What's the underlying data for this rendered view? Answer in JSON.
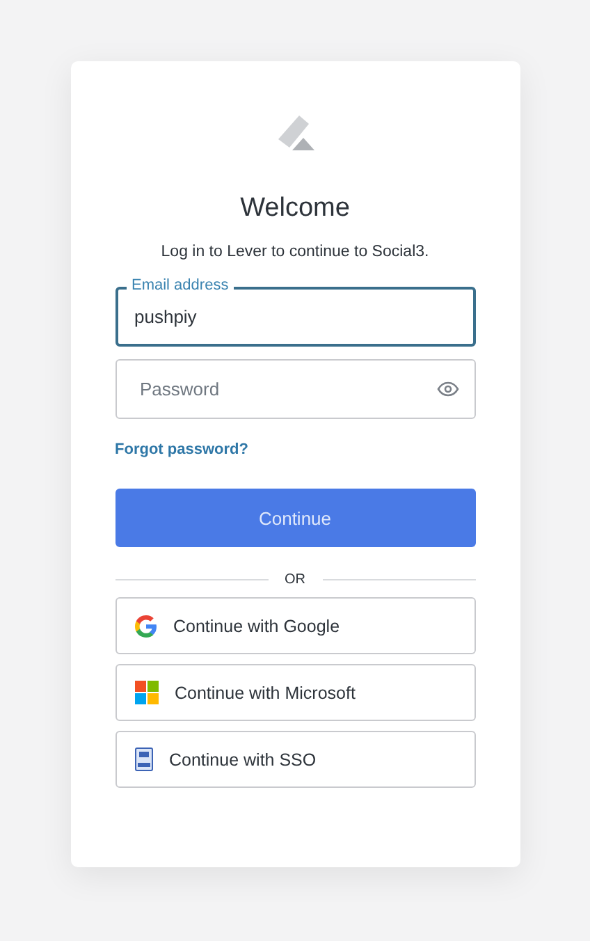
{
  "heading": "Welcome",
  "subtitle": "Log in to Lever to continue to Social3.",
  "email": {
    "label": "Email address",
    "value": "pushpiy",
    "focused": true
  },
  "password": {
    "placeholder": "Password"
  },
  "forgot_link": "Forgot password?",
  "continue_button": "Continue",
  "divider": "OR",
  "providers": [
    {
      "kind": "google",
      "label": "Continue with Google"
    },
    {
      "kind": "microsoft",
      "label": "Continue with Microsoft"
    },
    {
      "kind": "sso",
      "label": "Continue with SSO"
    }
  ]
}
